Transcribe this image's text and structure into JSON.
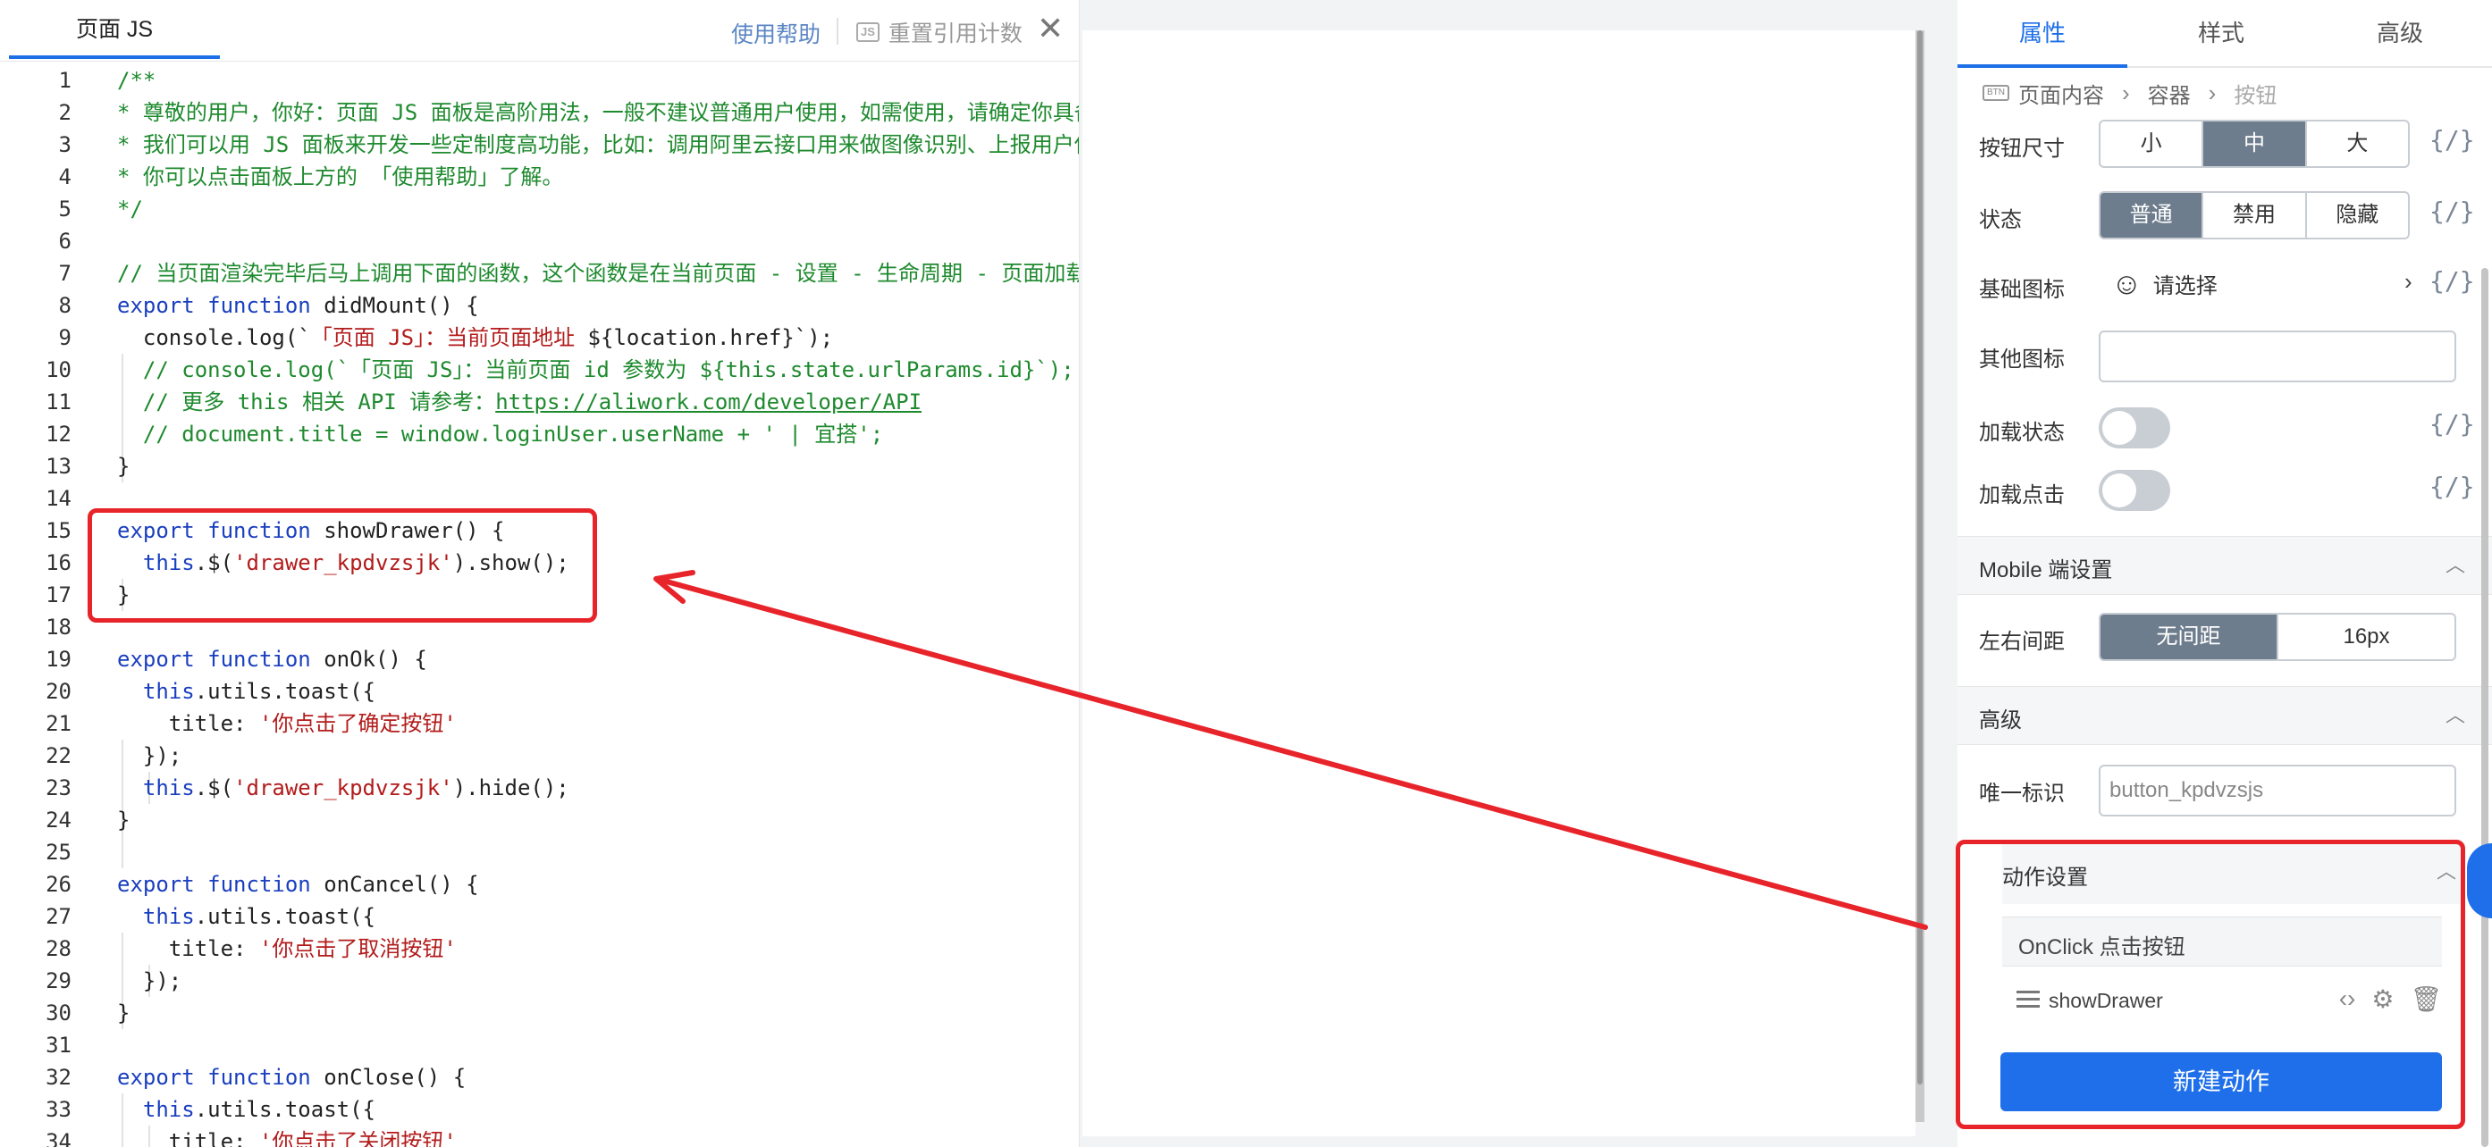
{
  "js_panel": {
    "tab_title": "页面 JS",
    "help_link": "使用帮助",
    "reset_badge": "JS",
    "reset_label": "重置引用计数",
    "close": "✕",
    "lines": [
      "/**",
      "* 尊敬的用户，你好：页面 JS 面板是高阶用法，一般不建议普通用户使用，如需使用，请确定你具备",
      "* 我们可以用 JS 面板来开发一些定制度高功能，比如：调用阿里云接口用来做图像识别、上报用户使",
      "* 你可以点击面板上方的 「使用帮助」了解。",
      "*/",
      "",
      "// 当页面渲染完毕后马上调用下面的函数，这个函数是在当前页面 - 设置 - 生命周期 - 页面加载",
      "export function didMount() {",
      "  console.log(`「页面 JS」：当前页面地址 ${location.href}`);",
      "  // console.log(`「页面 JS」：当前页面 id 参数为 ${this.state.urlParams.id}`);",
      "  // 更多 this 相关 API 请参考：https://aliwork.com/developer/API",
      "  // document.title = window.loginUser.userName + ' | 宜搭';",
      "}",
      "",
      "export function showDrawer() {",
      "  this.$('drawer_kpdvzsjk').show();",
      "}",
      "",
      "export function onOk() {",
      "  this.utils.toast({",
      "    title: '你点击了确定按钮'",
      "  });",
      "  this.$('drawer_kpdvzsjk').hide();",
      "}",
      "",
      "export function onCancel() {",
      "  this.utils.toast({",
      "    title: '你点击了取消按钮'",
      "  });",
      "}",
      "",
      "export function onClose() {",
      "  this.utils.toast({",
      "    title: '你点击了关闭按钮'"
    ]
  },
  "props": {
    "tabs": [
      "属性",
      "样式",
      "高级"
    ],
    "active_tab": 0,
    "breadcrumb": {
      "icon": "BTN",
      "items": [
        "页面内容",
        "容器",
        "按钮"
      ],
      "sep": "›"
    },
    "expr": "{/}",
    "button_size": {
      "label": "按钮尺寸",
      "options": [
        "小",
        "中",
        "大"
      ],
      "selected": 1
    },
    "state": {
      "label": "状态",
      "options": [
        "普通",
        "禁用",
        "隐藏"
      ],
      "selected": 0
    },
    "base_icon": {
      "label": "基础图标",
      "value": "请选择",
      "smile": "☺",
      "arrow": "›"
    },
    "other_icon": {
      "label": "其他图标",
      "value": ""
    },
    "loading_state": {
      "label": "加载状态",
      "on": false
    },
    "loading_click": {
      "label": "加载点击",
      "on": false
    },
    "mobile_section": {
      "title": "Mobile 端设置",
      "chev": "︿"
    },
    "spacing": {
      "label": "左右间距",
      "options": [
        "无间距",
        "16px"
      ],
      "selected": 0
    },
    "advanced_section": {
      "title": "高级",
      "chev": "︿"
    },
    "unique_id": {
      "label": "唯一标识",
      "value": "button_kpdvzsjs"
    },
    "action_section": {
      "title": "动作设置",
      "chev": "︿"
    },
    "event": "OnClick 点击按钮",
    "action": {
      "name": "showDrawer",
      "code_icon": "‹›",
      "gear_icon": "⚙",
      "trash_icon": "🗑"
    },
    "new_action": "新建动作"
  },
  "colors": {
    "accent": "#1d6fe8",
    "highlight": "#e8242b",
    "selected_segment": "#6e7d8e"
  }
}
